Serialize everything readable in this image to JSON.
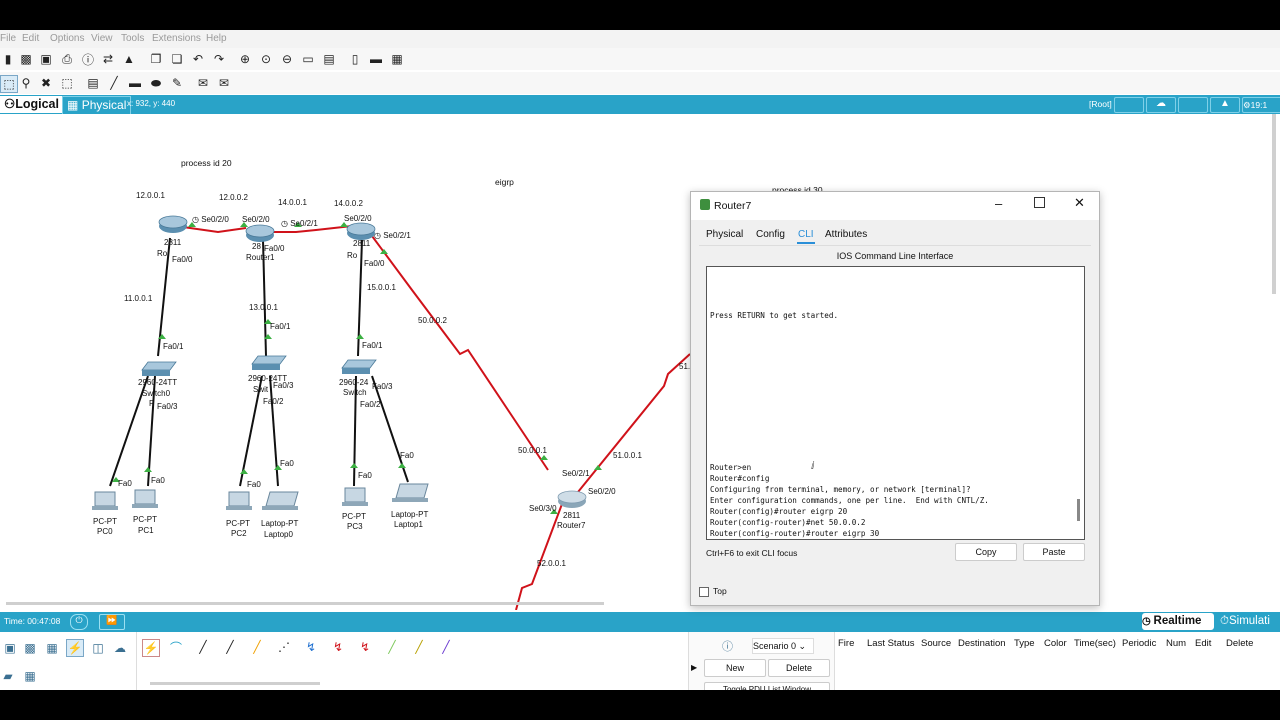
{
  "menu": [
    "File",
    "Edit",
    "Options",
    "View",
    "Tools",
    "Extensions",
    "Help"
  ],
  "tabs": {
    "logical": "Logical",
    "physical": "Physical",
    "coords": "x: 932, y: 440",
    "root": "[Root]",
    "clock": "19:1"
  },
  "annotations": {
    "process20": "process id 20",
    "eigrp": "eigrp",
    "process30": "process id 30"
  },
  "networks": {
    "n12": "12.0.0.1",
    "n12b": "12.0.0.2",
    "n14": "14.0.0.1",
    "n14b": "14.0.0.2",
    "n11": "11.0.0.1",
    "n13": "13.0.0.1",
    "n15": "15.0.0.1",
    "n50": "50.0.0.2",
    "n50b": "50.0.0.1",
    "n51": "51.0.0.1",
    "n51b": "51.",
    "n52": "52.0.0.1"
  },
  "interfaces": {
    "r0_se": "Se0/2/0",
    "r1_se0": "Se0/2/0",
    "r1_se1": "Se0/2/1",
    "r2_se0": "Se0/2/0",
    "r2_se1": "Se0/2/1",
    "r0_fa": "Fa0/0",
    "r1_fa": "Fa0/0",
    "r2_fa": "Fa0/0",
    "s0_fa1": "Fa0/1",
    "s1_fa1": "Fa0/1",
    "s2_fa1": "Fa0/1",
    "s0_fa3": "Fa0/3",
    "s1_fa3": "Fa0/3",
    "s1_fa2": "Fa0/2",
    "s2_fa3": "Fa0/3",
    "s2_fa2": "Fa0/2",
    "pc0_fa": "Fa0",
    "pc1_fa": "Fa0",
    "pc2_fa": "Fa0",
    "lap0_fa": "Fa0",
    "pc3_fa": "Fa0",
    "lap1_fa": "Fa0",
    "r7_se1": "Se0/2/1",
    "r7_se0": "Se0/2/0",
    "r7_se30": "Se0/3/0"
  },
  "devices": {
    "r0_model": "2811",
    "r0_name": "Ro",
    "r1_model": "28",
    "r1_name": "Router1",
    "r2_model": "2811",
    "r2_name": "Ro",
    "sw0_model": "2960-24TT",
    "sw0_name": "Switch0",
    "sw1_model": "2960-24TT",
    "sw1_name": "Swit",
    "sw2_model": "2960-24",
    "sw2_name": "Switch",
    "pc0_type": "PC-PT",
    "pc0_name": "PC0",
    "pc1_type": "PC-PT",
    "pc1_name": "PC1",
    "pc2_type": "PC-PT",
    "pc2_name": "PC2",
    "lap0_type": "Laptop-PT",
    "lap0_name": "Laptop0",
    "pc3_type": "PC-PT",
    "pc3_name": "PC3",
    "lap1_type": "Laptop-PT",
    "lap1_name": "Laptop1",
    "r7_model": "2811",
    "r7_name": "Router7",
    "sw0_f": "F"
  },
  "dialog": {
    "title": "Router7",
    "tabs": [
      "Physical",
      "Config",
      "CLI",
      "Attributes"
    ],
    "heading": "IOS Command Line Interface",
    "cli_lines": [
      "Press RETURN to get started.",
      "Router>en",
      "Router#config",
      "Configuring from terminal, memory, or network [terminal]?",
      "Enter configuration commands, one per line.  End with CNTL/Z.",
      "Router(config)#router eigrp 20",
      "Router(config-router)#net 50.0.0.2",
      "Router(config-router)#router eigrp 30"
    ],
    "hint": "Ctrl+F6 to exit CLI focus",
    "copy": "Copy",
    "paste": "Paste",
    "top": "Top"
  },
  "timebar": {
    "time": "Time: 00:47:08",
    "realtime": "Realtime",
    "simulation": "Simulati"
  },
  "pdu": {
    "scenario": "Scenario 0",
    "new": "New",
    "delete": "Delete",
    "toggle": "Toggle PDU List Window",
    "columns": [
      "Fire",
      "Last Status",
      "Source",
      "Destination",
      "Type",
      "Color",
      "Time(sec)",
      "Periodic",
      "Num",
      "Edit",
      "Delete"
    ]
  },
  "colors": {
    "accent": "#29a3c8",
    "serial": "#d0121a",
    "ethernet": "#111111",
    "link_up": "#3cb043"
  }
}
